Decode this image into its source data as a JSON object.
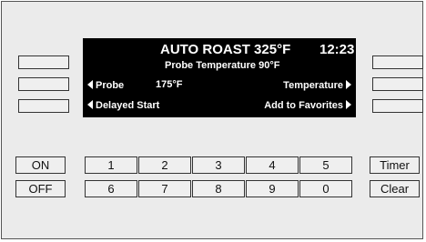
{
  "display": {
    "mode_title": "AUTO ROAST 325°F",
    "clock": "12:23",
    "subtitle": "Probe Temperature 90°F",
    "left_option_1": "Probe",
    "probe_value": "175°F",
    "right_option_1": "Temperature",
    "left_option_2": "Delayed Start",
    "right_option_2": "Add to Favorites"
  },
  "keypad": {
    "on": "ON",
    "off": "OFF",
    "timer": "Timer",
    "clear": "Clear",
    "digits_row1": [
      "1",
      "2",
      "3",
      "4",
      "5"
    ],
    "digits_row2": [
      "6",
      "7",
      "8",
      "9",
      "0"
    ]
  }
}
